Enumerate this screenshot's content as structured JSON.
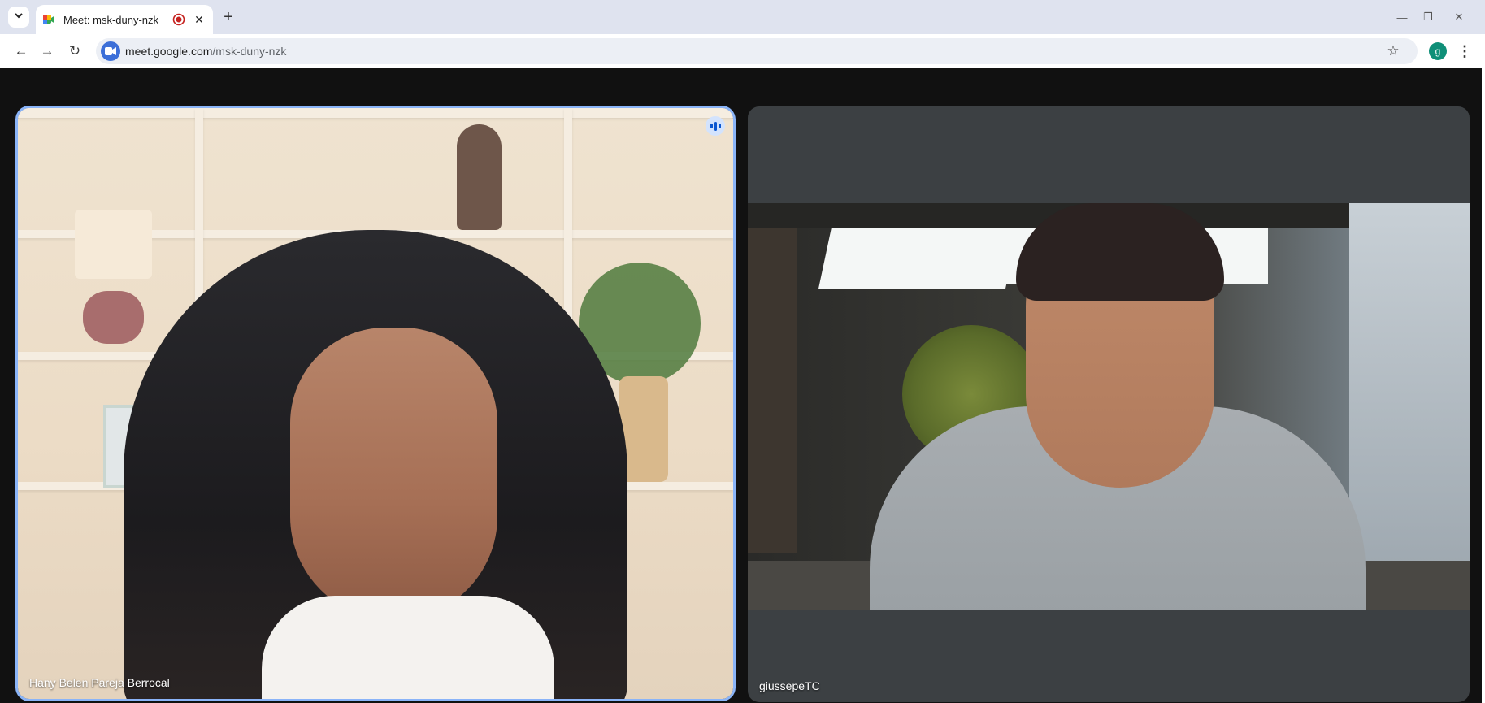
{
  "browser": {
    "tab": {
      "title": "Meet: msk-duny-nzk",
      "close_symbol": "✕"
    },
    "new_tab_symbol": "+",
    "window_controls": {
      "minimize": "—",
      "restore": "❐",
      "close": "✕"
    },
    "toolbar": {
      "url_host": "meet.google.com",
      "url_path": "/msk-duny-nzk",
      "back_symbol": "←",
      "forward_symbol": "→",
      "reload_symbol": "↻",
      "bookmark_symbol": "☆",
      "profile_initial": "g",
      "menu_symbol": "⋮"
    }
  },
  "meet": {
    "participants": [
      {
        "name": "Hany Belen Pareja Berrocal",
        "speaking": true
      },
      {
        "name": "giussepeTC",
        "speaking": false
      }
    ]
  },
  "colors": {
    "tab_bar": "#dfe3ef",
    "meet_background": "#111111",
    "active_speaker_border": "#8ab4f8",
    "tile_background": "#3c4043"
  },
  "icons": [
    "tab-list-icon",
    "meet-favicon-icon",
    "recording-icon",
    "close-icon",
    "plus-icon",
    "back-icon",
    "forward-icon",
    "reload-icon",
    "meet-site-icon",
    "star-icon",
    "kebab-menu-icon",
    "audio-speaking-icon"
  ]
}
